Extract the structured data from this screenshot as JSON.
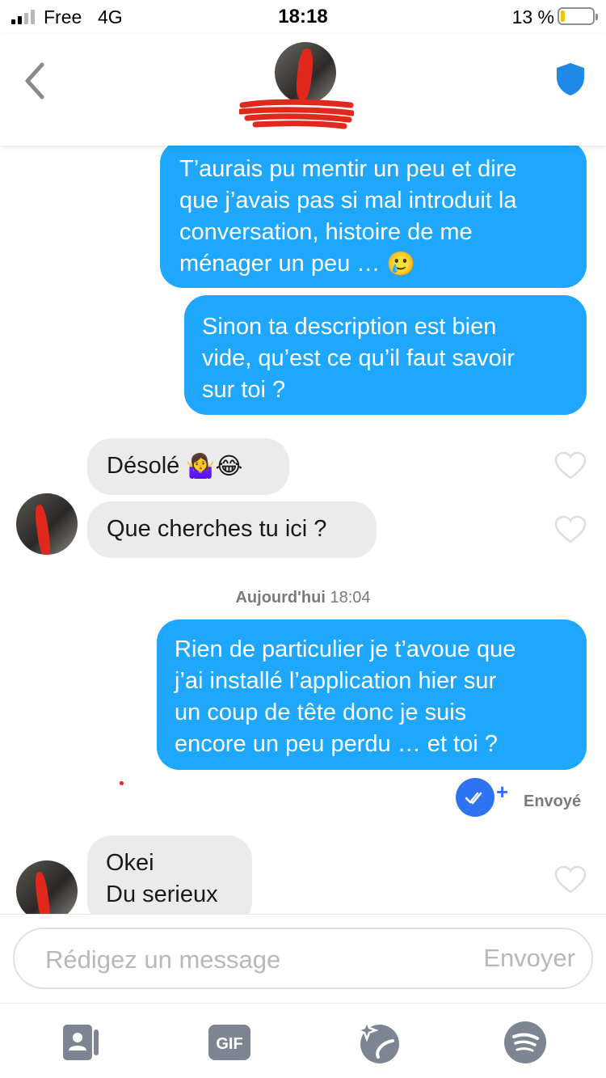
{
  "status_bar": {
    "carrier": "Free",
    "network": "4G",
    "time": "18:18",
    "battery_percent": "13 %",
    "battery_level": 0.13
  },
  "header": {
    "back_icon": "chevron-left-icon",
    "safety_icon": "shield-icon",
    "accent_color": "#1e88e5"
  },
  "messages": [
    {
      "direction": "outgoing",
      "lines": [
        "T’aurais pu mentir un peu et dire",
        "que j’avais pas si mal introduit la",
        "conversation, histoire de me",
        "ménager un peu …"
      ],
      "emoji": "🥲"
    },
    {
      "direction": "outgoing",
      "lines": [
        "Sinon ta description est bien",
        "vide, qu’est ce qu’il faut savoir",
        "sur toi ?"
      ]
    },
    {
      "direction": "incoming",
      "text": "Désolé",
      "emoji": "🤷‍♀️😂"
    },
    {
      "direction": "incoming",
      "text": "Que cherches tu ici ?"
    },
    {
      "direction": "outgoing",
      "lines": [
        "Rien de particulier je t’avoue que",
        "j’ai installé l’application hier sur",
        "un coup de tête donc je suis",
        "encore un peu perdu … et toi ?"
      ]
    },
    {
      "direction": "incoming",
      "lines": [
        "Okei",
        "Du serieux"
      ]
    }
  ],
  "date_divider": {
    "day": "Aujourd'hui",
    "time": "18:04"
  },
  "sent_status": {
    "label": "Envoyé",
    "plus": "+"
  },
  "composer": {
    "placeholder": "Rédigez un message",
    "send_label": "Envoyer"
  },
  "toolbar": {
    "items": [
      {
        "icon": "contact-card-icon"
      },
      {
        "icon": "gif-icon",
        "label": "GIF"
      },
      {
        "icon": "sparkle-music-icon"
      },
      {
        "icon": "spotify-icon"
      }
    ]
  },
  "colors": {
    "outgoing_bubble": "#1ea7fd",
    "incoming_bubble": "#ebebeb",
    "sent_check": "#2f73f5"
  }
}
